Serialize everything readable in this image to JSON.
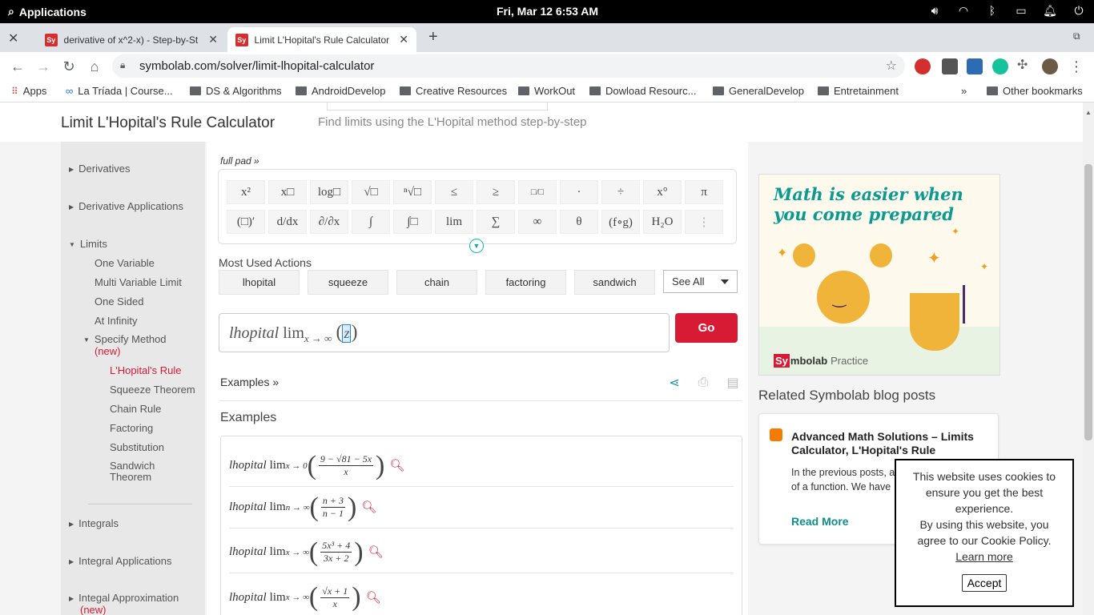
{
  "system_bar": {
    "apps_label": "Applications",
    "clock": "Fri, Mar 12   6:53 AM"
  },
  "tabs": [
    {
      "favicon": "Sy",
      "title": "derivative of x^2-x) - Step-by-St"
    },
    {
      "favicon": "Sy",
      "title": "Limit L'Hopital's Rule Calculator"
    }
  ],
  "address_bar": {
    "url": "symbolab.com/solver/limit-lhopital-calculator"
  },
  "bookmarks": {
    "items": [
      "Apps",
      "La Tríada | Course...",
      "DS & Algorithms",
      "AndroidDevelop",
      "Creative Resources",
      "WorkOut",
      "Dowload Resourc...",
      "GeneralDevelop",
      "Entretainment"
    ],
    "other": "Other bookmarks"
  },
  "header": {
    "title": "Limit L'Hopital's Rule Calculator",
    "subtitle": "Find limits using the L'Hopital method step-by-step"
  },
  "sidebar": {
    "derivatives": "Derivatives",
    "derivative_applications": "Derivative Applications",
    "limits": "Limits",
    "one_variable": "One Variable",
    "multi_variable": "Multi Variable Limit",
    "one_sided": "One Sided",
    "at_infinity": "At Infinity",
    "specify_method": "Specify Method",
    "new_badge": "(new)",
    "lhopital": "L'Hopital's Rule",
    "squeeze": "Squeeze Theorem",
    "chain": "Chain Rule",
    "factoring": "Factoring",
    "substitution": "Substitution",
    "sandwich_1": "Sandwich",
    "sandwich_2": "Theorem",
    "integrals": "Integrals",
    "integral_applications": "Integral Applications",
    "integral_approx": "Integal Approximation",
    "new_badge2": "(new)"
  },
  "keypad": {
    "full_pad": "full pad »",
    "row1": [
      "x²",
      "x□",
      "log□",
      "√□",
      "ⁿ√□",
      "≤",
      "≥",
      "□/□",
      "·",
      "÷",
      "x°",
      "π"
    ],
    "row2": [
      "(□)′",
      "d/dx",
      "∂/∂x",
      "∫",
      "∫□",
      "lim",
      "∑",
      "∞",
      "θ",
      "(f∘g)",
      "H₂O",
      "⋮"
    ]
  },
  "actions": {
    "title": "Most Used Actions",
    "items": [
      "lhopital",
      "squeeze",
      "chain",
      "factoring",
      "sandwich"
    ],
    "see_all": "See All"
  },
  "input": {
    "prefix": "lhopital",
    "lim": "lim",
    "sub": "x → ∞",
    "open": "(",
    "var": "z",
    "close": ")",
    "go": "Go"
  },
  "examples": {
    "link": "Examples »",
    "title": "Examples",
    "rows": [
      {
        "prefix": "lhopital",
        "lim": "lim",
        "sub": "x → 0",
        "num": "9 − √81 − 5x",
        "den": "x"
      },
      {
        "prefix": "lhopital",
        "lim": "lim",
        "sub": "n → ∞",
        "num": "n + 3",
        "den": "n − 1"
      },
      {
        "prefix": "lhopital",
        "lim": "lim",
        "sub": "x → ∞",
        "num": "5x³ + 4",
        "den": "3x + 2"
      },
      {
        "prefix": "lhopital",
        "lim": "lim",
        "sub": "x → ∞",
        "num": "√x + 1",
        "den": "x"
      }
    ]
  },
  "ad": {
    "headline": "Math is easier when you come prepared",
    "brand_sy": "Sy",
    "brand_rest": "mbolab",
    "brand_practice": "Practice"
  },
  "related": {
    "title": "Related Symbolab blog posts",
    "card_title": "Advanced Math Solutions – Limits Calculator, L'Hopital's Rule",
    "card_body": "In the previous posts, about different ways t of a function. We have",
    "read_more": "Read More"
  },
  "cookie": {
    "text1": "This website uses cookies to ensure you get the best experience.",
    "text2": "By using this website, you agree to our Cookie Policy.",
    "learn_more": "Learn more",
    "accept": "Accept"
  },
  "colors": {
    "accent_red": "#d81b35",
    "teal": "#0e8f8a"
  }
}
